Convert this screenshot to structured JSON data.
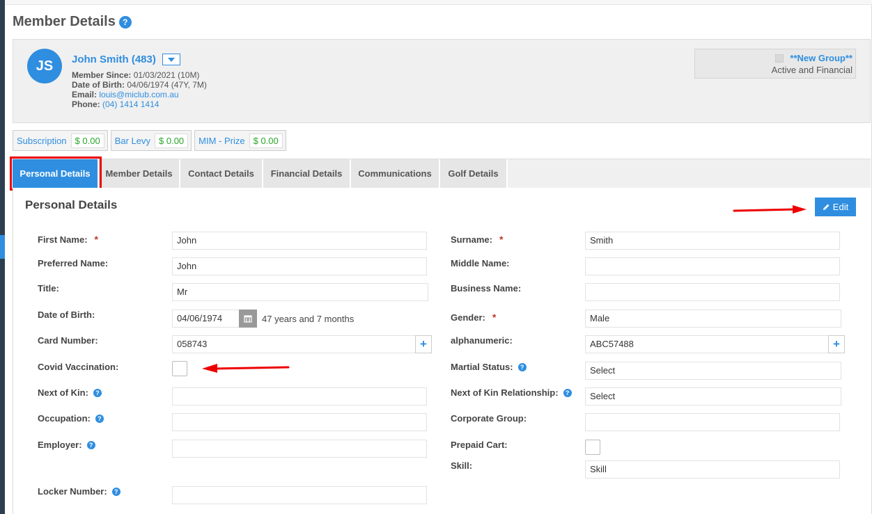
{
  "page": {
    "title": "Member Details"
  },
  "member": {
    "initials": "JS",
    "name": "John Smith (483)",
    "since_label": "Member Since:",
    "since_value": "01/03/2021 (10M)",
    "dob_label": "Date of Birth:",
    "dob_value": "04/06/1974 (47Y, 7M)",
    "email_label": "Email:",
    "email_value": "louis@miclub.com.au",
    "phone_label": "Phone:",
    "phone_value": "(04) 1414 1414"
  },
  "group": {
    "name": "**New Group**",
    "status": "Active and Financial"
  },
  "balances": [
    {
      "label": "Subscription",
      "value": "$ 0.00"
    },
    {
      "label": "Bar Levy",
      "value": "$ 0.00"
    },
    {
      "label": "MIM - Prize",
      "value": "$ 0.00"
    }
  ],
  "tabs": [
    {
      "label": "Personal Details",
      "active": true
    },
    {
      "label": "Member Details"
    },
    {
      "label": "Contact Details"
    },
    {
      "label": "Financial Details"
    },
    {
      "label": "Communications"
    },
    {
      "label": "Golf Details"
    }
  ],
  "section": {
    "title": "Personal Details",
    "edit_label": "Edit"
  },
  "fields": {
    "first_name": {
      "label": "First Name:",
      "value": "John"
    },
    "preferred_name": {
      "label": "Preferred Name:",
      "value": "John"
    },
    "title": {
      "label": "Title:",
      "value": "Mr"
    },
    "dob": {
      "label": "Date of Birth:",
      "value": "04/06/1974",
      "age": "47 years and 7 months"
    },
    "card_number": {
      "label": "Card Number:",
      "value": "058743"
    },
    "covid": {
      "label": "Covid Vaccination:"
    },
    "next_of_kin": {
      "label": "Next of Kin:",
      "value": ""
    },
    "occupation": {
      "label": "Occupation:",
      "value": ""
    },
    "employer": {
      "label": "Employer:",
      "value": ""
    },
    "locker": {
      "label": "Locker Number:",
      "value": ""
    },
    "surname": {
      "label": "Surname:",
      "value": "Smith"
    },
    "middle_name": {
      "label": "Middle Name:",
      "value": ""
    },
    "business_name": {
      "label": "Business Name:",
      "value": ""
    },
    "gender": {
      "label": "Gender:",
      "value": "Male"
    },
    "alphanumeric": {
      "label": "alphanumeric:",
      "value": "ABC57488"
    },
    "martial_status": {
      "label": "Martial Status:",
      "value": "Select"
    },
    "nok_relationship": {
      "label": "Next of Kin Relationship:",
      "value": "Select"
    },
    "corporate_group": {
      "label": "Corporate Group:",
      "value": ""
    },
    "prepaid_cart": {
      "label": "Prepaid Cart:"
    },
    "skill": {
      "label": "Skill:",
      "placeholder": "Skill"
    }
  },
  "required_mark": "*",
  "help_mark": "?",
  "colors": {
    "accent": "#2f8ee0",
    "amount": "#2aa62a",
    "annotation": "#e00000"
  }
}
